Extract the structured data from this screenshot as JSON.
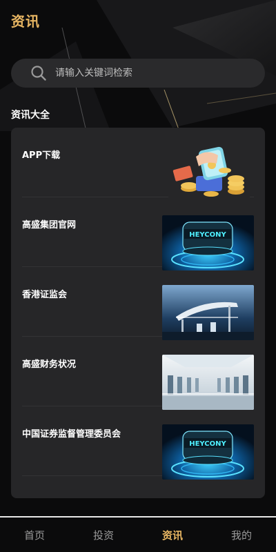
{
  "header": {
    "title": "资讯"
  },
  "search": {
    "placeholder": "请输入关键词检索"
  },
  "section": {
    "title": "资讯大全"
  },
  "news": [
    {
      "title": "APP下载",
      "thumb": "coins-phone-illustration"
    },
    {
      "title": "高盛集团官网",
      "thumb": "heycony-device-image"
    },
    {
      "title": "香港证监会",
      "thumb": "charging-station-image"
    },
    {
      "title": "高盛财务状况",
      "thumb": "charging-hall-image"
    },
    {
      "title": "中国证券监督管理委员会",
      "thumb": "heycony-device-image"
    }
  ],
  "thumb_text": "HEYCONY",
  "tabs": [
    {
      "label": "首页"
    },
    {
      "label": "投资"
    },
    {
      "label": "资讯",
      "active": true
    },
    {
      "label": "我的"
    }
  ],
  "colors": {
    "accent": "#e8b663",
    "card": "#262628",
    "background": "#0b0b0c"
  }
}
